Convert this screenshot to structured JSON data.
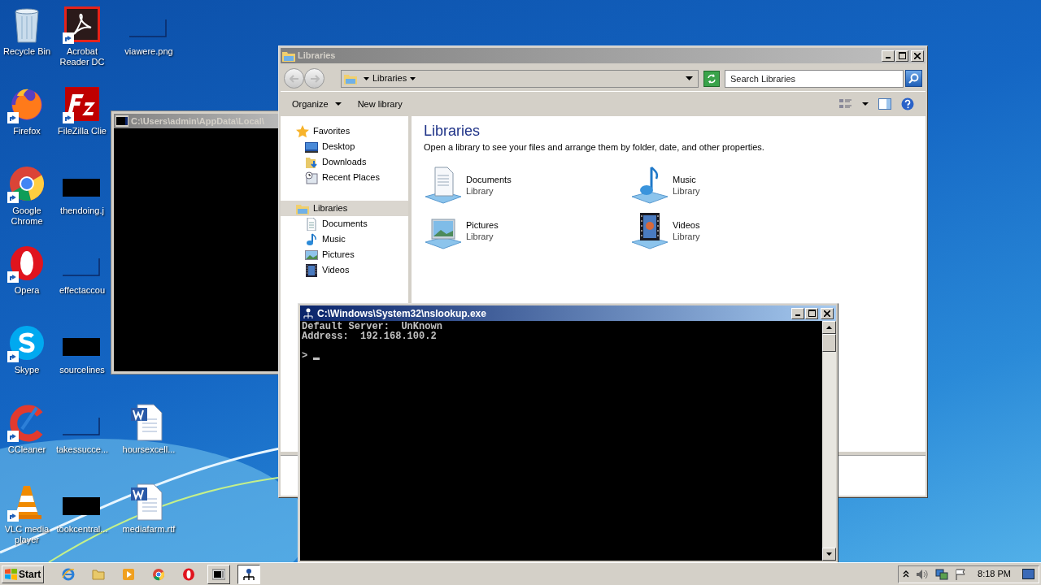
{
  "desktop": {
    "columns": [
      {
        "icons": [
          {
            "label": "Recycle Bin",
            "kind": "recycle-bin",
            "shortcut": false
          },
          {
            "label": "Firefox",
            "kind": "firefox",
            "shortcut": true
          },
          {
            "label": "Google Chrome",
            "kind": "chrome",
            "shortcut": true
          },
          {
            "label": "Opera",
            "kind": "opera",
            "shortcut": true
          },
          {
            "label": "Skype",
            "kind": "skype",
            "shortcut": true
          },
          {
            "label": "CCleaner",
            "kind": "ccleaner",
            "shortcut": true
          },
          {
            "label": "VLC media player",
            "kind": "vlc",
            "shortcut": true
          }
        ]
      },
      {
        "icons": [
          {
            "label": "Acrobat Reader DC",
            "kind": "acrobat",
            "shortcut": true
          },
          {
            "label": "FileZilla Clie",
            "kind": "filezilla",
            "shortcut": true
          },
          {
            "label": "thendoing.j",
            "kind": "dark-thumb",
            "shortcut": false
          },
          {
            "label": "effectaccou",
            "kind": "faint-thumb",
            "shortcut": false
          },
          {
            "label": "sourcelines",
            "kind": "dark-thumb",
            "shortcut": false
          },
          {
            "label": "takessucce...",
            "kind": "faint-thumb",
            "shortcut": false
          },
          {
            "label": "tookcentral...",
            "kind": "dark-thumb",
            "shortcut": false
          }
        ]
      },
      {
        "icons": [
          {
            "label": "viawere.png",
            "kind": "faint-thumb",
            "shortcut": false
          },
          {
            "label": "hoursexcell...",
            "kind": "word",
            "shortcut": false
          },
          {
            "label": "mediafarm.rtf",
            "kind": "word",
            "shortcut": false
          }
        ]
      }
    ]
  },
  "console_window": {
    "title": "C:\\Users\\admin\\AppData\\Local\\",
    "active": false
  },
  "explorer": {
    "title": "Libraries",
    "active": false,
    "address": "Libraries",
    "search": {
      "placeholder": "Search Libraries"
    },
    "toolbar": [
      {
        "label": "Organize",
        "dropdown": true
      },
      {
        "label": "New library",
        "dropdown": false
      }
    ],
    "nav": [
      {
        "label": "Favorites",
        "kind": "star",
        "selected": false,
        "children": [
          {
            "label": "Desktop",
            "kind": "desktop",
            "selected": false
          },
          {
            "label": "Downloads",
            "kind": "downloads",
            "selected": false
          },
          {
            "label": "Recent Places",
            "kind": "recent",
            "selected": false
          }
        ]
      },
      {
        "label": "Libraries",
        "kind": "libraries",
        "selected": true,
        "children": [
          {
            "label": "Documents",
            "kind": "documents",
            "selected": false
          },
          {
            "label": "Music",
            "kind": "music",
            "selected": false
          },
          {
            "label": "Pictures",
            "kind": "pictures",
            "selected": false
          },
          {
            "label": "Videos",
            "kind": "videos",
            "selected": false
          }
        ]
      }
    ],
    "heading": "Libraries",
    "description": "Open a library to see your files and arrange them by folder, date, and other properties.",
    "libraries": [
      {
        "name": "Documents",
        "type": "Library",
        "kind": "documents"
      },
      {
        "name": "Music",
        "type": "Library",
        "kind": "music"
      },
      {
        "name": "Pictures",
        "type": "Library",
        "kind": "pictures"
      },
      {
        "name": "Videos",
        "type": "Library",
        "kind": "videos"
      }
    ]
  },
  "nslookup_window": {
    "title": "C:\\Windows\\System32\\nslookup.exe",
    "active": true,
    "lines": [
      "Default Server:  UnKnown",
      "Address:  192.168.100.2"
    ],
    "prompt": ">"
  },
  "taskbar": {
    "start": "Start",
    "apps": [
      {
        "kind": "ie",
        "selected": false
      },
      {
        "kind": "folder",
        "selected": false
      },
      {
        "kind": "media",
        "selected": false
      },
      {
        "kind": "chrome",
        "selected": false
      },
      {
        "kind": "opera",
        "selected": false
      },
      {
        "kind": "console",
        "selected": false
      },
      {
        "kind": "network",
        "selected": true
      }
    ],
    "clock": "8:18 PM"
  }
}
